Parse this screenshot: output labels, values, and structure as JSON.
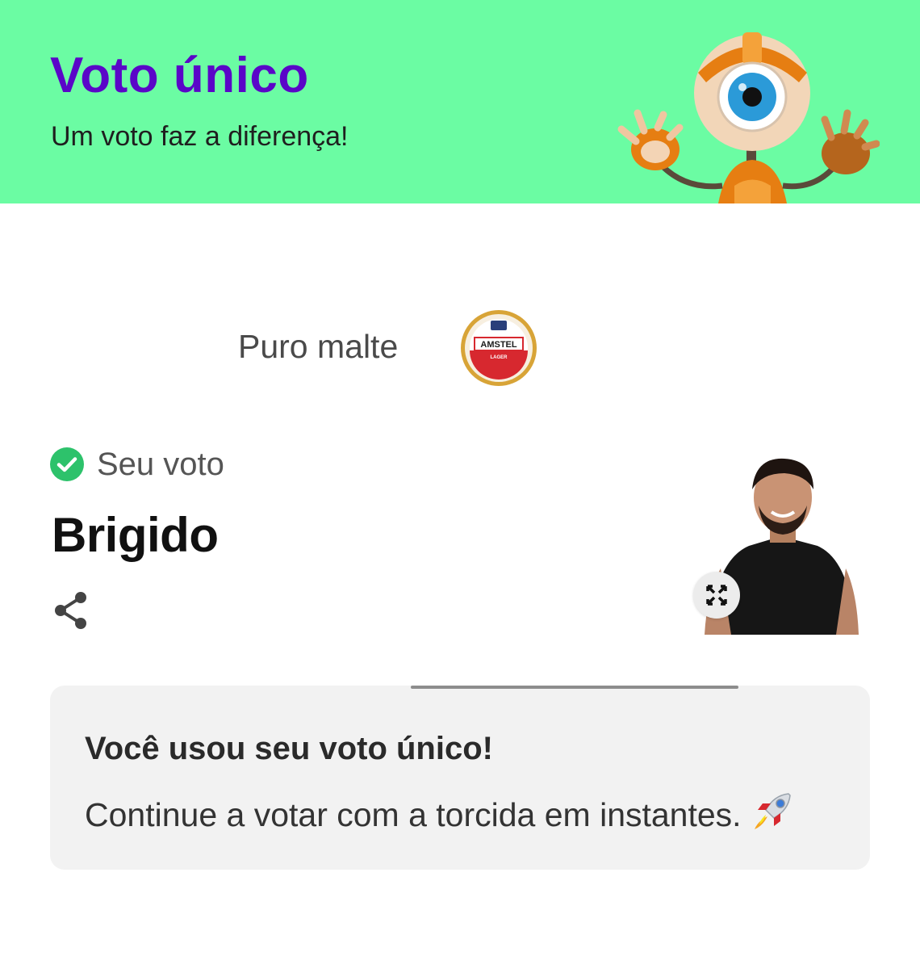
{
  "header": {
    "title": "Voto único",
    "subtitle": "Um voto faz a diferença!",
    "mascot_icon": "big-brother-eye-robot",
    "background_color": "#6bfca3",
    "title_color": "#5a06c8"
  },
  "sponsor": {
    "label": "Puro malte",
    "logo_icon": "amstel-lager-logo",
    "logo_text": "AMSTEL",
    "logo_subtext": "LAGER"
  },
  "vote": {
    "status_icon": "check-circle-icon",
    "status_label": "Seu voto",
    "candidate_name": "Brigido",
    "share_icon": "share-icon",
    "expand_icon": "expand-icon",
    "status_color": "#2dc26b"
  },
  "card": {
    "title": "Você usou seu voto único!",
    "text": "Continue a votar com a torcida em instantes.",
    "emoji_icon": "rocket-icon"
  }
}
